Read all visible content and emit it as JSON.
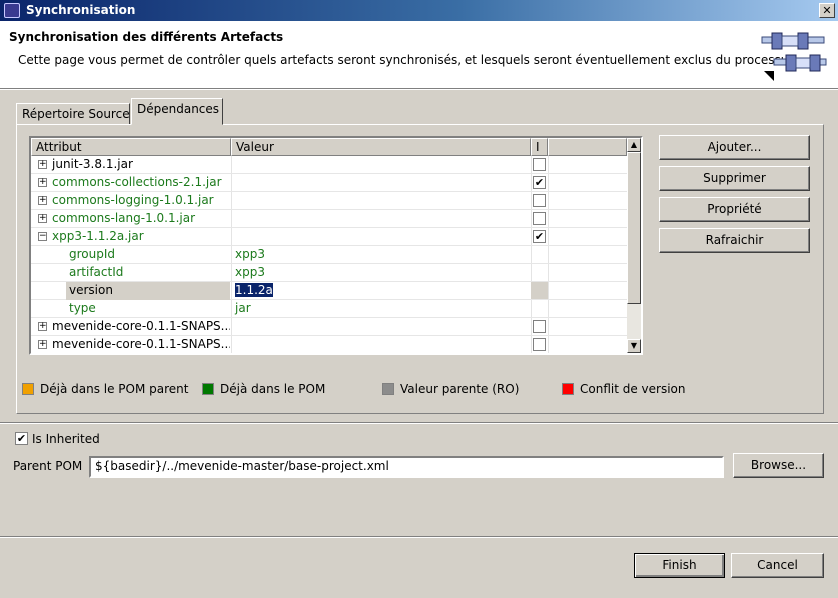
{
  "window": {
    "title": "Synchronisation"
  },
  "header": {
    "title": "Synchronisation des différents Artefacts",
    "description": "Cette page vous permet de contrôler quels artefacts seront synchronisés, et lesquels seront éventuellement exclus du processus",
    "icon": "sync-banner-icon"
  },
  "tabs": [
    {
      "label": "Répertoire Source",
      "active": false
    },
    {
      "label": "Dépendances",
      "active": true
    }
  ],
  "table": {
    "columns": [
      "Attribut",
      "Valeur",
      "I"
    ],
    "rows": [
      {
        "label": "junit-3.8.1.jar",
        "value": "",
        "checked": false,
        "expander": "+",
        "green": false
      },
      {
        "label": "commons-collections-2.1.jar",
        "value": "",
        "checked": true,
        "expander": "+",
        "green": true
      },
      {
        "label": "commons-logging-1.0.1.jar",
        "value": "",
        "checked": false,
        "expander": "+",
        "green": true
      },
      {
        "label": "commons-lang-1.0.1.jar",
        "value": "",
        "checked": false,
        "expander": "+",
        "green": true
      },
      {
        "label": "xpp3-1.1.2a.jar",
        "value": "",
        "checked": true,
        "expander": "−",
        "green": true
      },
      {
        "label": "groupId",
        "value": "xpp3",
        "green": true
      },
      {
        "label": "artifactId",
        "value": "xpp3",
        "green": true
      },
      {
        "label": "version",
        "value": "1.1.2a",
        "green": false,
        "selected": true
      },
      {
        "label": "type",
        "value": "jar",
        "green": true
      },
      {
        "label": "mevenide-core-0.1.1-SNAPS...",
        "value": "",
        "checked": false,
        "expander": "+",
        "green": false
      },
      {
        "label": "mevenide-core-0.1.1-SNAPS...",
        "value": "",
        "checked": false,
        "expander": "+",
        "green": false
      }
    ]
  },
  "side_buttons": [
    "Ajouter...",
    "Supprimer",
    "Propriété",
    "Rafraichir"
  ],
  "legend": [
    {
      "label": "Déjà dans le POM parent",
      "color": "#f0a000"
    },
    {
      "label": "Déjà dans le POM",
      "color": "#007800"
    },
    {
      "label": "Valeur parente (RO)",
      "color": "#8c8c8c"
    },
    {
      "label": "Conflit de version",
      "color": "#ff0000"
    }
  ],
  "inherited": {
    "label": "Is Inherited",
    "checked": true
  },
  "parent_pom": {
    "label": "Parent POM",
    "value": "${basedir}/../mevenide-master/base-project.xml",
    "browse_label": "Browse..."
  },
  "footer": {
    "finish_label": "Finish",
    "cancel_label": "Cancel"
  }
}
